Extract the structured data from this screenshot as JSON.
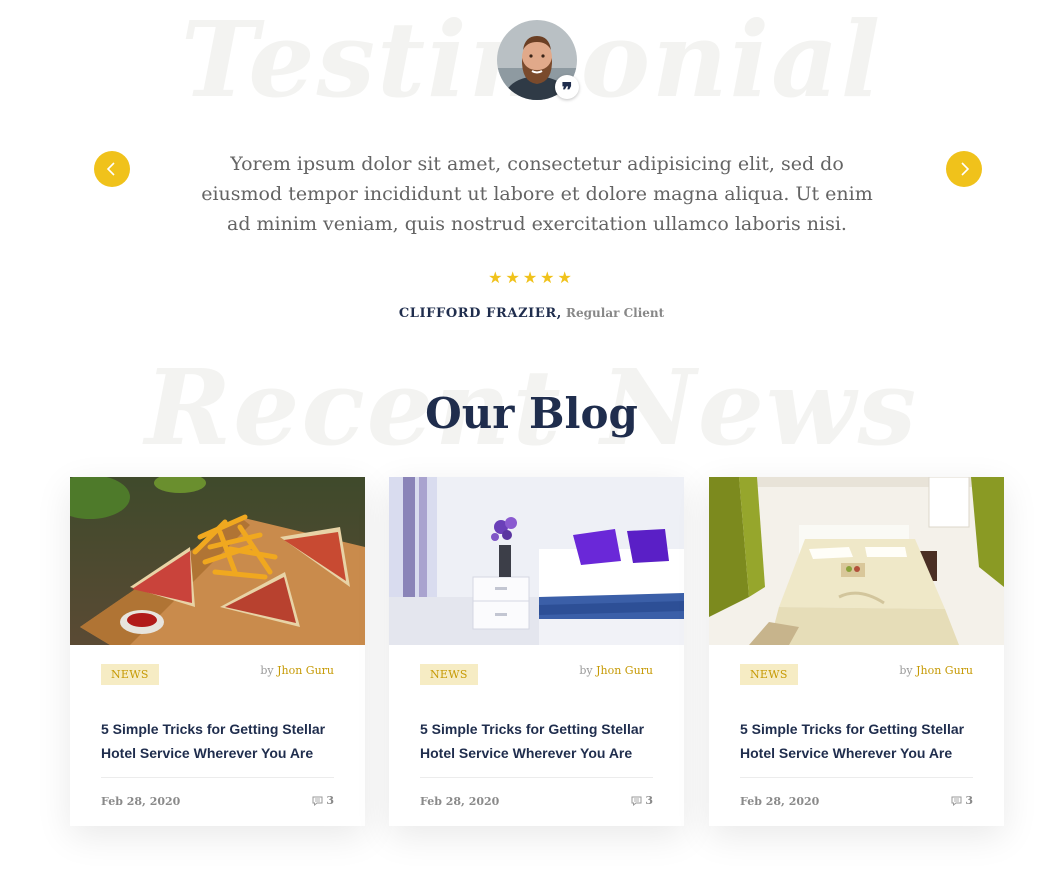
{
  "testimonial": {
    "bg_word": "Testimonial",
    "quote": "Yorem ipsum dolor sit amet, consectetur adipisicing elit, sed do eiusmod tempor incididunt ut labore et dolore magna aliqua. Ut enim ad minim veniam, quis nostrud exercitation ullamco laboris nisi.",
    "stars": "★★★★★",
    "rating": 5,
    "client_name": "CLIFFORD FRAZIER,",
    "client_role": "Regular Client",
    "quote_mark": "❞",
    "nav": {
      "prev_icon": "chevron-left-icon",
      "next_icon": "chevron-right-icon"
    }
  },
  "blog": {
    "bg_word": "Recent News",
    "title": "Our Blog",
    "posts": [
      {
        "tag": "NEWS",
        "author_prefix": "by",
        "author": "Jhon Guru",
        "title": "5 Simple Tricks for Getting Stellar Hotel Service Wherever You Are",
        "date": "Feb 28, 2020",
        "comments": "3",
        "image": "sandwich-fries-photo"
      },
      {
        "tag": "NEWS",
        "author_prefix": "by",
        "author": "Jhon Guru",
        "title": "5 Simple Tricks for Getting Stellar Hotel Service Wherever You Are",
        "date": "Feb 28, 2020",
        "comments": "3",
        "image": "white-bedroom-photo"
      },
      {
        "tag": "NEWS",
        "author_prefix": "by",
        "author": "Jhon Guru",
        "title": "5 Simple Tricks for Getting Stellar Hotel Service Wherever You Are",
        "date": "Feb 28, 2020",
        "comments": "3",
        "image": "hotel-room-photo"
      }
    ]
  },
  "colors": {
    "accent": "#f0c21b",
    "heading": "#1f2d4d",
    "tag_bg": "#f6ecc4",
    "tag_text": "#c69a05"
  }
}
